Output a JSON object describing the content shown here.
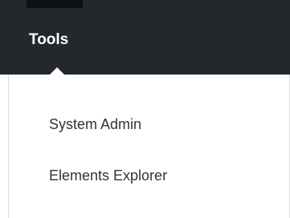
{
  "menu": {
    "title": "Tools",
    "items": [
      {
        "label": "System Admin"
      },
      {
        "label": "Elements Explorer"
      }
    ]
  }
}
